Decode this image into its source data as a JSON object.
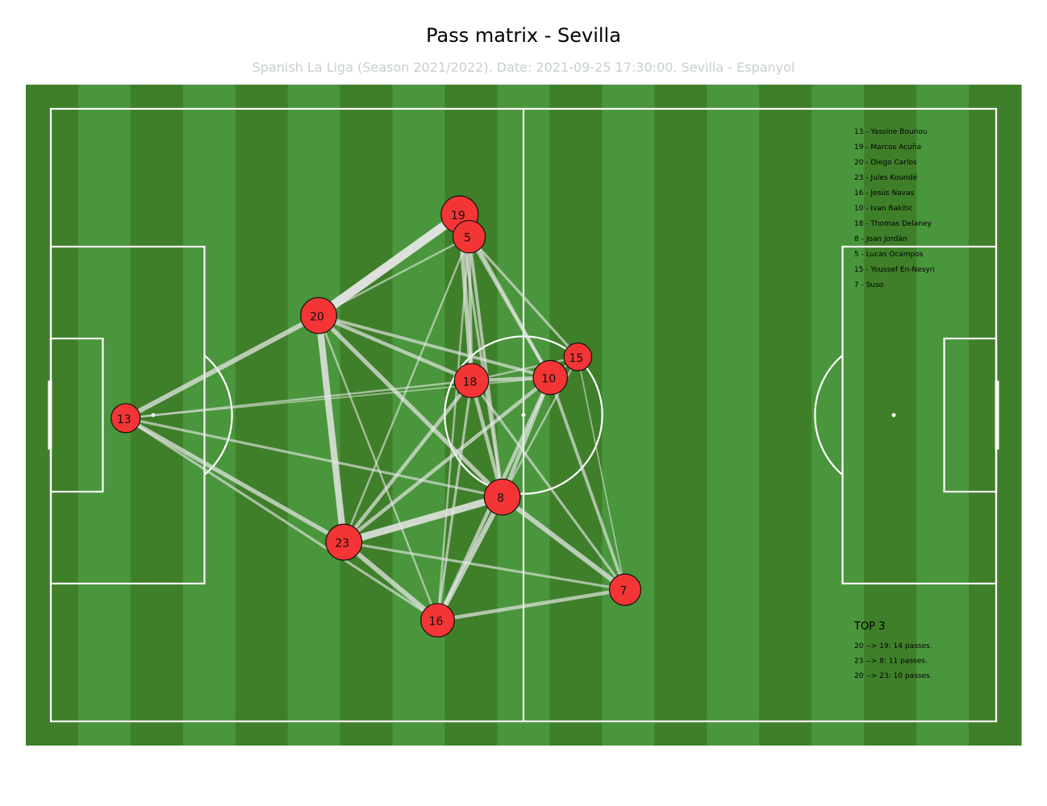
{
  "header": {
    "title": "Pass matrix - Sevilla",
    "subtitle": "Spanish La Liga (Season 2021/2022). Date: 2021-09-25 17:30:00. Sevilla - Espanyol"
  },
  "colors": {
    "grass_light": "#4a963c",
    "grass_dark": "#3f7f2a",
    "lines": "#ffffff",
    "pass_line": "#e6e6e6",
    "node_fill": "#f33535",
    "node_stroke": "#111111"
  },
  "chart_data": {
    "type": "network",
    "pitch": {
      "x_range": [
        0,
        120
      ],
      "y_range": [
        0,
        80
      ]
    },
    "nodes": [
      {
        "id": "13",
        "name": "Yassine Bounou",
        "x": 9.5,
        "y": 39.6,
        "count": 22
      },
      {
        "id": "19",
        "name": "Marcos Acuña",
        "x": 51.9,
        "y": 66.2,
        "count": 58
      },
      {
        "id": "20",
        "name": "Diego Carlos",
        "x": 34.0,
        "y": 53.0,
        "count": 52
      },
      {
        "id": "23",
        "name": "Jules Koundé",
        "x": 37.2,
        "y": 23.4,
        "count": 52
      },
      {
        "id": "16",
        "name": "Jesús Navas",
        "x": 49.1,
        "y": 13.2,
        "count": 40
      },
      {
        "id": "10",
        "name": "Ivan Rakitic",
        "x": 63.4,
        "y": 44.9,
        "count": 43
      },
      {
        "id": "18",
        "name": "Thomas Delaney",
        "x": 53.4,
        "y": 44.5,
        "count": 43
      },
      {
        "id": "8",
        "name": "Joan Jordán",
        "x": 57.3,
        "y": 29.3,
        "count": 52
      },
      {
        "id": "5",
        "name": "Lucas Ocampos",
        "x": 53.1,
        "y": 63.3,
        "count": 35
      },
      {
        "id": "15",
        "name": "Youssef En-Nesyri",
        "x": 66.9,
        "y": 47.6,
        "count": 18
      },
      {
        "id": "7",
        "name": "Suso",
        "x": 72.9,
        "y": 17.2,
        "count": 31
      }
    ],
    "edges": [
      {
        "from": "20",
        "to": "19",
        "count": 14
      },
      {
        "from": "23",
        "to": "8",
        "count": 11
      },
      {
        "from": "20",
        "to": "23",
        "count": 10
      },
      {
        "from": "13",
        "to": "20",
        "count": 7
      },
      {
        "from": "13",
        "to": "23",
        "count": 6
      },
      {
        "from": "13",
        "to": "16",
        "count": 3
      },
      {
        "from": "13",
        "to": "18",
        "count": 2
      },
      {
        "from": "13",
        "to": "8",
        "count": 3
      },
      {
        "from": "20",
        "to": "5",
        "count": 2
      },
      {
        "from": "20",
        "to": "18",
        "count": 5
      },
      {
        "from": "20",
        "to": "10",
        "count": 4
      },
      {
        "from": "20",
        "to": "8",
        "count": 6
      },
      {
        "from": "20",
        "to": "16",
        "count": 2
      },
      {
        "from": "19",
        "to": "18",
        "count": 6
      },
      {
        "from": "19",
        "to": "10",
        "count": 4
      },
      {
        "from": "19",
        "to": "8",
        "count": 3
      },
      {
        "from": "5",
        "to": "18",
        "count": 4
      },
      {
        "from": "5",
        "to": "10",
        "count": 4
      },
      {
        "from": "5",
        "to": "15",
        "count": 3
      },
      {
        "from": "5",
        "to": "8",
        "count": 4
      },
      {
        "from": "5",
        "to": "23",
        "count": 2
      },
      {
        "from": "5",
        "to": "16",
        "count": 2
      },
      {
        "from": "18",
        "to": "10",
        "count": 5
      },
      {
        "from": "18",
        "to": "8",
        "count": 5
      },
      {
        "from": "18",
        "to": "23",
        "count": 5
      },
      {
        "from": "18",
        "to": "16",
        "count": 3
      },
      {
        "from": "18",
        "to": "7",
        "count": 3
      },
      {
        "from": "10",
        "to": "15",
        "count": 2
      },
      {
        "from": "10",
        "to": "8",
        "count": 5
      },
      {
        "from": "10",
        "to": "23",
        "count": 5
      },
      {
        "from": "10",
        "to": "16",
        "count": 5
      },
      {
        "from": "10",
        "to": "7",
        "count": 4
      },
      {
        "from": "15",
        "to": "7",
        "count": 1
      },
      {
        "from": "15",
        "to": "8",
        "count": 2
      },
      {
        "from": "15",
        "to": "18",
        "count": 2
      },
      {
        "from": "8",
        "to": "16",
        "count": 7
      },
      {
        "from": "8",
        "to": "7",
        "count": 7
      },
      {
        "from": "23",
        "to": "16",
        "count": 7
      },
      {
        "from": "23",
        "to": "7",
        "count": 3
      },
      {
        "from": "16",
        "to": "7",
        "count": 5
      },
      {
        "from": "13",
        "to": "10",
        "count": 1
      }
    ],
    "legend": [
      "13 - Yassine Bounou",
      "19 - Marcos Acuña",
      "20 - Diego Carlos",
      "23 - Jules Koundé",
      "16 - Jesús Navas",
      "10 - Ivan Rakitic",
      "18 - Thomas Delaney",
      "8 - Joan Jordán",
      "5 - Lucas Ocampos",
      "15 - Youssef En-Nesyri",
      "7 - Suso"
    ],
    "top3_title": "TOP 3",
    "top3": [
      "20 --> 19: 14 passes.",
      "23 --> 8: 11 passes.",
      "20 --> 23: 10 passes."
    ]
  }
}
